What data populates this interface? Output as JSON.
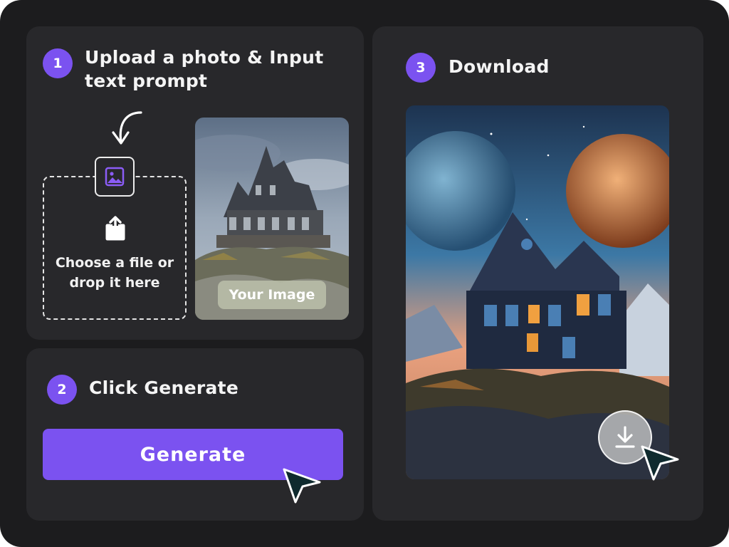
{
  "step1": {
    "number": "1",
    "title": "Upload a photo & Input text prompt",
    "dropzone_text": "Choose a file or drop it here",
    "image_tag": "Your Image",
    "icons": [
      "curved-arrow-icon",
      "image-icon",
      "upload-icon"
    ]
  },
  "step2": {
    "number": "2",
    "title": "Click Generate",
    "button_label": "Generate",
    "icons": [
      "cursor-pointer-icon"
    ]
  },
  "step3": {
    "number": "3",
    "title": "Download",
    "icons": [
      "download-icon",
      "cursor-pointer-icon"
    ]
  },
  "colors": {
    "accent": "#7b52f0",
    "background": "#1c1c1e",
    "panel": "#28282b",
    "text": "#f4f4f4"
  }
}
